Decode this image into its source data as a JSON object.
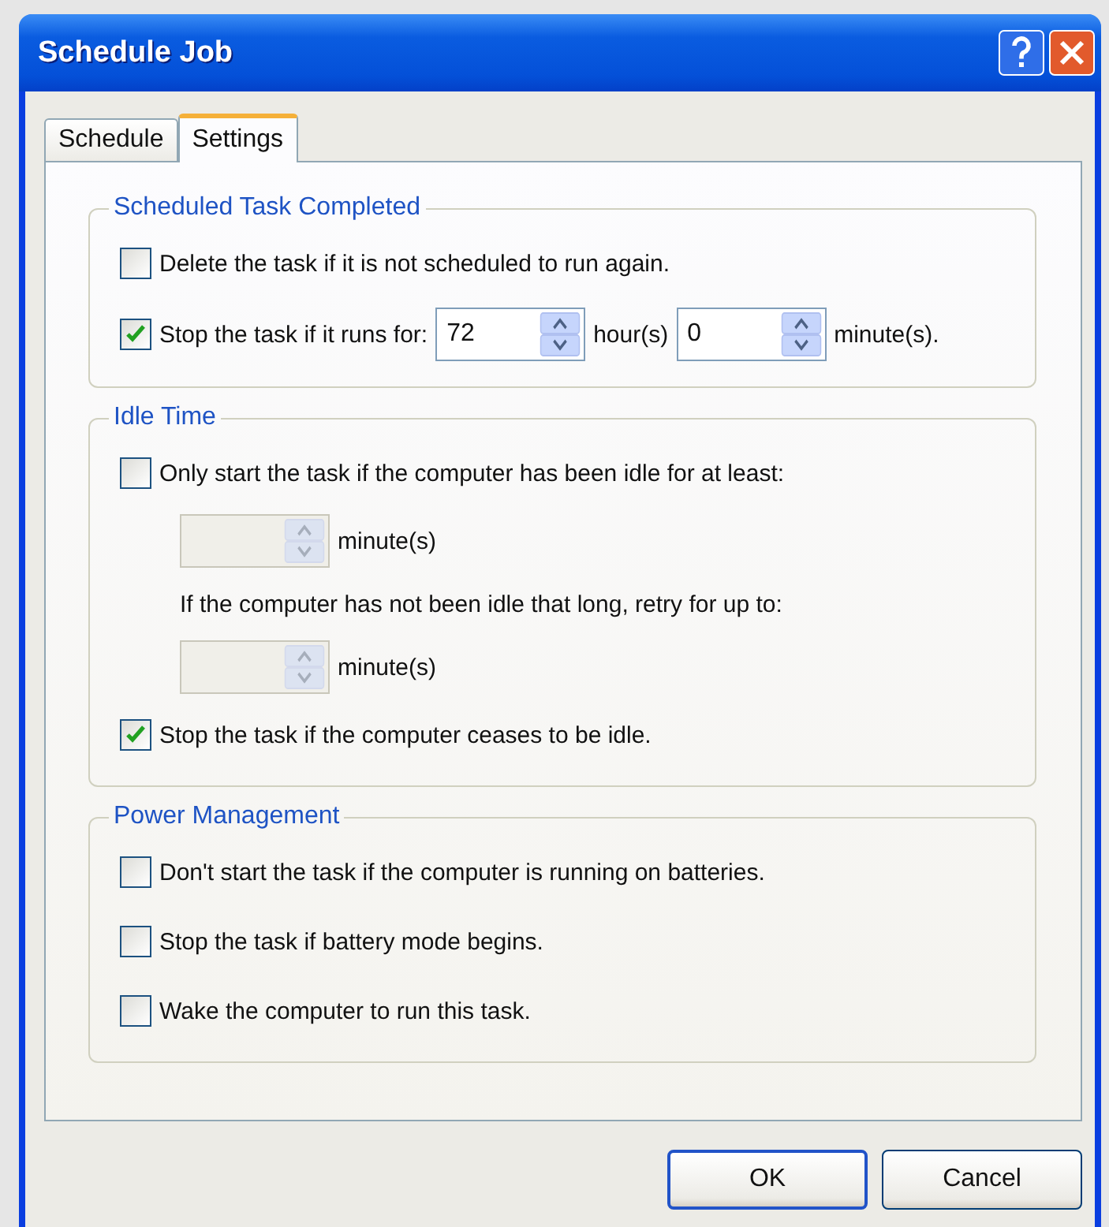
{
  "window": {
    "title": "Schedule Job"
  },
  "tabs": [
    {
      "label": "Schedule",
      "selected": false
    },
    {
      "label": "Settings",
      "selected": true
    }
  ],
  "groups": [
    {
      "title": "Scheduled Task Completed",
      "rows": [
        {
          "kind": "checkbox",
          "label": "Delete the task if it is not scheduled to run again.",
          "checked": false
        },
        {
          "kind": "checkbox_spin",
          "label": "Stop the task if it runs for:",
          "checked": true,
          "fields": [
            {
              "value": "72",
              "unit": "hour(s)",
              "disabled": false
            },
            {
              "value": "0",
              "unit": "minute(s).",
              "disabled": false
            }
          ]
        }
      ]
    },
    {
      "title": "Idle Time",
      "rows": [
        {
          "kind": "checkbox",
          "label": "Only start the task if the computer has been idle for at least:",
          "checked": false
        },
        {
          "kind": "spin",
          "unit": "minute(s)",
          "disabled": true
        },
        {
          "kind": "text",
          "text": "If the computer has not been idle that long, retry for up to:"
        },
        {
          "kind": "spin",
          "unit": "minute(s)",
          "disabled": true
        },
        {
          "kind": "checkbox",
          "label": "Stop the task if the computer ceases to be idle.",
          "checked": true
        }
      ]
    },
    {
      "title": "Power Management",
      "rows": [
        {
          "kind": "checkbox",
          "label": "Don't start the task if the computer is running on batteries.",
          "checked": false
        },
        {
          "kind": "checkbox",
          "label": "Stop the task if battery mode begins.",
          "checked": false
        },
        {
          "kind": "checkbox",
          "label": "Wake the computer to run this task.",
          "checked": false
        }
      ]
    }
  ],
  "buttons": [
    {
      "label": "OK",
      "default": true
    },
    {
      "label": "Cancel",
      "default": false
    }
  ]
}
